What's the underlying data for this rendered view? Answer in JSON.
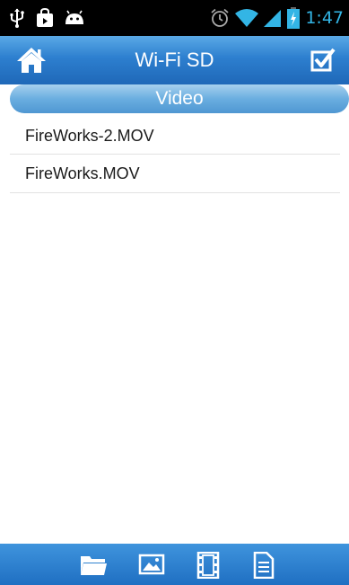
{
  "status_bar": {
    "time": "1:47",
    "icons": [
      "usb-icon",
      "bag-icon",
      "android-icon",
      "alarm-icon",
      "wifi-icon",
      "signal-icon",
      "battery-icon"
    ]
  },
  "header": {
    "title": "Wi-Fi SD",
    "left_icon": "home-icon",
    "right_icon": "checkbox-icon",
    "background": "#2d7fcf"
  },
  "section": {
    "title": "Video"
  },
  "files": [
    {
      "name": "FireWorks-2.MOV"
    },
    {
      "name": "FireWorks.MOV"
    }
  ],
  "bottom_nav": {
    "items": [
      "folder-icon",
      "image-icon",
      "film-icon",
      "document-icon"
    ]
  },
  "colors": {
    "accent": "#33b5e5",
    "bar_blue": "#1f6fc2",
    "section_blue": "#6aaee0"
  }
}
